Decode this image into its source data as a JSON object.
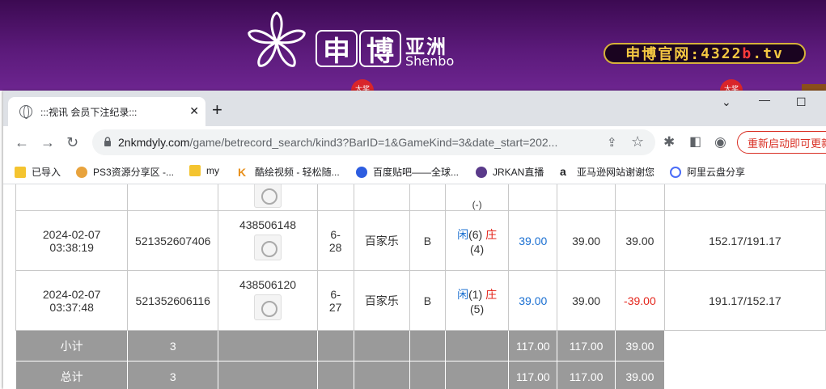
{
  "banner": {
    "logo_char1": "申",
    "logo_char2": "博",
    "logo_cn": "亚洲",
    "logo_en": "Shenbo",
    "site_prefix": "申博官网:",
    "site_num": "4322",
    "site_b": "b",
    "site_tld": ".tv",
    "badge_text": "大奖"
  },
  "browser": {
    "tab_title": ":::视讯 会员下注纪录:::",
    "url_host": "2nkmdyly.com",
    "url_path": "/game/betrecord_search/kind3?BarID=1&GameKind=3&date_start=202...",
    "update_label": "重新启动即可更新"
  },
  "bookmarks": [
    {
      "label": "已导入",
      "icon": "folder-icon"
    },
    {
      "label": "PS3资源分享区 -...",
      "icon": "ps3-site-icon"
    },
    {
      "label": "my",
      "icon": "folder-icon"
    },
    {
      "label": "酷绘视频 - 轻松随...",
      "icon": "k-site-icon"
    },
    {
      "label": "百度贴吧——全球...",
      "icon": "baidu-icon"
    },
    {
      "label": "JRKAN直播",
      "icon": "jrkan-icon"
    },
    {
      "label": "亚马逊网站谢谢您",
      "icon": "amazon-icon"
    },
    {
      "label": "阿里云盘分享",
      "icon": "aliyun-icon"
    }
  ],
  "table": {
    "top_partial": {
      "result": "(-)"
    },
    "rows": [
      {
        "date": "2024-02-07",
        "time": "03:38:19",
        "bet_id": "521352607406",
        "game_id": "438506148",
        "round_a": "6-",
        "round_b": "28",
        "game_type": "百家乐",
        "bet": "B",
        "player_label": "闲",
        "player_pts": "(6)",
        "banker_label": "庄",
        "banker_pts": "(4)",
        "amount": "39.00",
        "valid": "39.00",
        "winloss": "39.00",
        "balance": "152.17/191.17"
      },
      {
        "date": "2024-02-07",
        "time": "03:37:48",
        "bet_id": "521352606116",
        "game_id": "438506120",
        "round_a": "6-",
        "round_b": "27",
        "game_type": "百家乐",
        "bet": "B",
        "player_label": "闲",
        "player_pts": "(1)",
        "banker_label": "庄",
        "banker_pts": "(5)",
        "amount": "39.00",
        "valid": "39.00",
        "winloss": "-39.00",
        "balance": "191.17/152.17"
      }
    ],
    "subtotal": {
      "label": "小计",
      "count": "3",
      "amount": "117.00",
      "valid": "117.00",
      "winloss": "39.00"
    },
    "total": {
      "label": "总计",
      "count": "3",
      "amount": "117.00",
      "valid": "117.00",
      "winloss": "39.00"
    }
  },
  "colors": {
    "banner_purple": "#5b1a7a",
    "pill_gold": "#f5c842",
    "win_blue": "#1a6fd1",
    "loss_red": "#e4261c",
    "sum_gray": "#9a9a9a"
  }
}
